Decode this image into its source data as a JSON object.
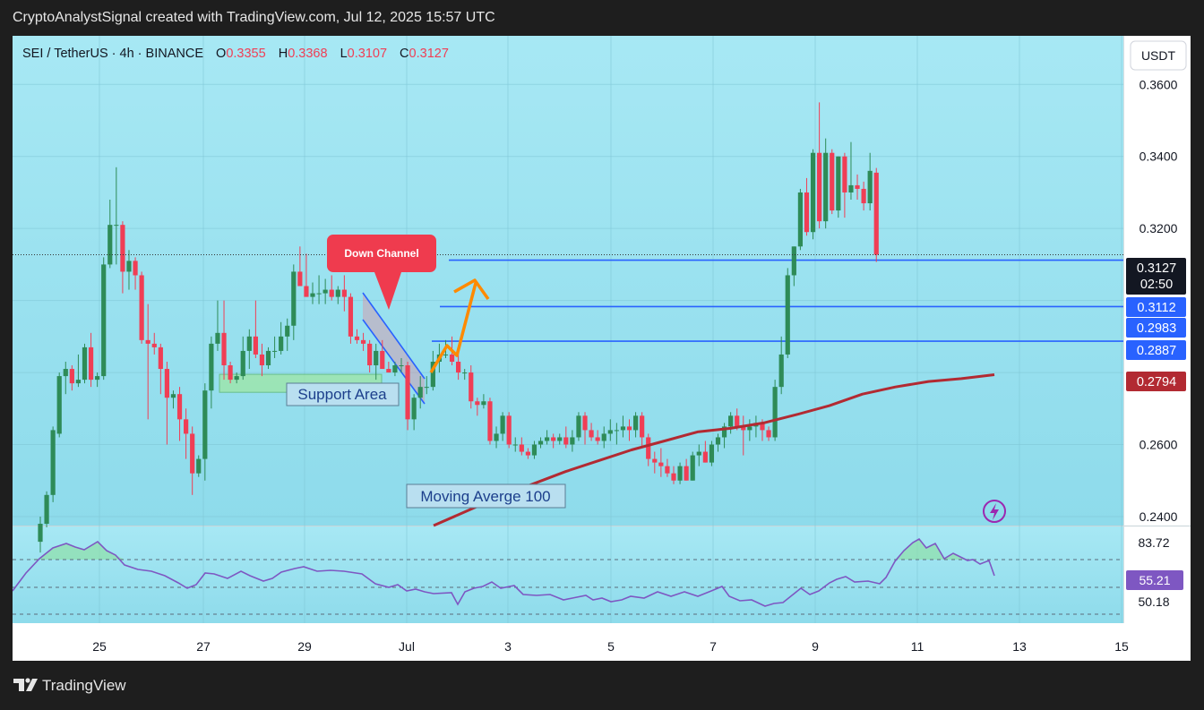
{
  "header": {
    "caption": "CryptoAnalystSignal created with TradingView.com, Jul 12, 2025 15:57 UTC"
  },
  "legend": {
    "symbol": "SEI / TetherUS · 4h · BINANCE",
    "open_label": "O",
    "open": "0.3355",
    "high_label": "H",
    "high": "0.3368",
    "low_label": "L",
    "low": "0.3107",
    "close_label": "C",
    "close": "0.3127"
  },
  "currency_button": "USDT",
  "footer": {
    "brand": "TradingView"
  },
  "colors": {
    "up": "#2e8b57",
    "down": "#f03e55",
    "ma": "#b22a32",
    "level": "#2962ff",
    "rsi": "#7e57c2",
    "bg_top": "#a7e8f4",
    "bg_bottom": "#8edbeb"
  },
  "annotations": {
    "down_channel": "Down Channel",
    "support_area": "Support Area",
    "moving_average": "Moving Averge 100"
  },
  "price_badges": {
    "last_price": "0.3127",
    "countdown": "02:50",
    "level_1": "0.3112",
    "level_2": "0.2983",
    "level_3": "0.2887",
    "ma_value": "0.2794"
  },
  "rsi_badges": {
    "top": "83.72",
    "current": "55.21",
    "bottom": "50.18"
  },
  "chart_data": {
    "type": "candlestick",
    "title": "SEI / TetherUS · 4h · BINANCE",
    "ohlc_last": {
      "open": 0.3355,
      "high": 0.3368,
      "low": 0.3107,
      "close": 0.3127
    },
    "y_ticks": [
      0.24,
      0.26,
      0.32,
      0.34,
      0.36
    ],
    "y_tick_labels": [
      "0.2400",
      "0.2600",
      "0.3200",
      "0.3400",
      "0.3600"
    ],
    "ylim": [
      0.2375,
      0.3735
    ],
    "x_ticks": [
      "25",
      "27",
      "29",
      "Jul",
      "3",
      "5",
      "7",
      "9",
      "11",
      "13",
      "15"
    ],
    "horizontal_levels": [
      0.3112,
      0.2983,
      0.2887
    ],
    "support_area": [
      0.2745,
      0.2795
    ],
    "moving_average_100": {
      "name": "Moving Averge 100",
      "values": [
        0.2375,
        0.2415,
        0.2455,
        0.249,
        0.2525,
        0.2555,
        0.2585,
        0.261,
        0.2635,
        0.2645,
        0.266,
        0.2683,
        0.2708,
        0.274,
        0.276,
        0.2775,
        0.2783,
        0.2794
      ]
    },
    "rsi": {
      "levels": [
        70,
        50,
        30
      ],
      "last": 55.21
    },
    "candles": [
      [
        0.233,
        0.24,
        0.23,
        0.238
      ],
      [
        0.238,
        0.247,
        0.237,
        0.246
      ],
      [
        0.246,
        0.265,
        0.244,
        0.264
      ],
      [
        0.263,
        0.28,
        0.262,
        0.279
      ],
      [
        0.279,
        0.283,
        0.274,
        0.281
      ],
      [
        0.281,
        0.282,
        0.275,
        0.277
      ],
      [
        0.277,
        0.285,
        0.276,
        0.278
      ],
      [
        0.278,
        0.288,
        0.277,
        0.287
      ],
      [
        0.287,
        0.291,
        0.276,
        0.278
      ],
      [
        0.278,
        0.28,
        0.276,
        0.279
      ],
      [
        0.279,
        0.312,
        0.278,
        0.31
      ],
      [
        0.31,
        0.328,
        0.309,
        0.321
      ],
      [
        0.321,
        0.337,
        0.31,
        0.321
      ],
      [
        0.321,
        0.322,
        0.302,
        0.308
      ],
      [
        0.308,
        0.314,
        0.303,
        0.311
      ],
      [
        0.311,
        0.312,
        0.303,
        0.307
      ],
      [
        0.307,
        0.308,
        0.288,
        0.289
      ],
      [
        0.289,
        0.299,
        0.267,
        0.288
      ],
      [
        0.288,
        0.291,
        0.285,
        0.287
      ],
      [
        0.287,
        0.288,
        0.274,
        0.281
      ],
      [
        0.281,
        0.283,
        0.26,
        0.273
      ],
      [
        0.273,
        0.275,
        0.27,
        0.274
      ],
      [
        0.274,
        0.276,
        0.261,
        0.267
      ],
      [
        0.267,
        0.27,
        0.256,
        0.263
      ],
      [
        0.263,
        0.265,
        0.246,
        0.252
      ],
      [
        0.252,
        0.257,
        0.251,
        0.256
      ],
      [
        0.256,
        0.277,
        0.25,
        0.275
      ],
      [
        0.275,
        0.29,
        0.27,
        0.288
      ],
      [
        0.288,
        0.3,
        0.286,
        0.291
      ],
      [
        0.291,
        0.3,
        0.278,
        0.282
      ],
      [
        0.282,
        0.283,
        0.277,
        0.278
      ],
      [
        0.278,
        0.28,
        0.277,
        0.279
      ],
      [
        0.279,
        0.29,
        0.278,
        0.286
      ],
      [
        0.286,
        0.292,
        0.281,
        0.29
      ],
      [
        0.29,
        0.3,
        0.284,
        0.285
      ],
      [
        0.285,
        0.288,
        0.279,
        0.282
      ],
      [
        0.282,
        0.287,
        0.281,
        0.286
      ],
      [
        0.286,
        0.29,
        0.284,
        0.286
      ],
      [
        0.286,
        0.294,
        0.285,
        0.29
      ],
      [
        0.29,
        0.295,
        0.286,
        0.293
      ],
      [
        0.293,
        0.31,
        0.289,
        0.308
      ],
      [
        0.308,
        0.315,
        0.305,
        0.304
      ],
      [
        0.304,
        0.313,
        0.301,
        0.301
      ],
      [
        0.301,
        0.305,
        0.299,
        0.302
      ],
      [
        0.302,
        0.307,
        0.299,
        0.302
      ],
      [
        0.302,
        0.306,
        0.299,
        0.303
      ],
      [
        0.303,
        0.307,
        0.3,
        0.301
      ],
      [
        0.301,
        0.304,
        0.299,
        0.303
      ],
      [
        0.303,
        0.307,
        0.297,
        0.301
      ],
      [
        0.301,
        0.302,
        0.288,
        0.29
      ],
      [
        0.29,
        0.292,
        0.288,
        0.289
      ],
      [
        0.289,
        0.291,
        0.286,
        0.288
      ],
      [
        0.288,
        0.289,
        0.28,
        0.282
      ],
      [
        0.282,
        0.288,
        0.278,
        0.286
      ],
      [
        0.286,
        0.289,
        0.282,
        0.281
      ],
      [
        0.281,
        0.283,
        0.28,
        0.28
      ],
      [
        0.28,
        0.283,
        0.279,
        0.282
      ],
      [
        0.282,
        0.284,
        0.28,
        0.282
      ],
      [
        0.282,
        0.283,
        0.264,
        0.267
      ],
      [
        0.267,
        0.274,
        0.264,
        0.273
      ],
      [
        0.273,
        0.279,
        0.27,
        0.276
      ],
      [
        0.276,
        0.279,
        0.274,
        0.276
      ],
      [
        0.276,
        0.286,
        0.275,
        0.283
      ],
      [
        0.283,
        0.288,
        0.28,
        0.285
      ],
      [
        0.285,
        0.289,
        0.284,
        0.285
      ],
      [
        0.285,
        0.29,
        0.282,
        0.283
      ],
      [
        0.283,
        0.286,
        0.278,
        0.28
      ],
      [
        0.28,
        0.281,
        0.278,
        0.28
      ],
      [
        0.28,
        0.282,
        0.27,
        0.272
      ],
      [
        0.272,
        0.273,
        0.268,
        0.271
      ],
      [
        0.271,
        0.274,
        0.27,
        0.272
      ],
      [
        0.272,
        0.273,
        0.26,
        0.261
      ],
      [
        0.261,
        0.265,
        0.259,
        0.263
      ],
      [
        0.263,
        0.269,
        0.261,
        0.268
      ],
      [
        0.268,
        0.269,
        0.259,
        0.26
      ],
      [
        0.26,
        0.262,
        0.258,
        0.26
      ],
      [
        0.26,
        0.262,
        0.257,
        0.258
      ],
      [
        0.258,
        0.259,
        0.256,
        0.257
      ],
      [
        0.257,
        0.261,
        0.256,
        0.26
      ],
      [
        0.26,
        0.262,
        0.259,
        0.261
      ],
      [
        0.261,
        0.264,
        0.26,
        0.262
      ],
      [
        0.262,
        0.263,
        0.259,
        0.261
      ],
      [
        0.261,
        0.263,
        0.26,
        0.262
      ],
      [
        0.262,
        0.265,
        0.259,
        0.26
      ],
      [
        0.26,
        0.264,
        0.258,
        0.262
      ],
      [
        0.262,
        0.269,
        0.261,
        0.268
      ],
      [
        0.268,
        0.269,
        0.26,
        0.264
      ],
      [
        0.264,
        0.266,
        0.261,
        0.262
      ],
      [
        0.262,
        0.264,
        0.26,
        0.261
      ],
      [
        0.261,
        0.265,
        0.259,
        0.263
      ],
      [
        0.263,
        0.267,
        0.261,
        0.264
      ],
      [
        0.264,
        0.266,
        0.26,
        0.264
      ],
      [
        0.264,
        0.268,
        0.262,
        0.265
      ],
      [
        0.265,
        0.267,
        0.261,
        0.264
      ],
      [
        0.264,
        0.269,
        0.262,
        0.268
      ],
      [
        0.268,
        0.269,
        0.259,
        0.262
      ],
      [
        0.262,
        0.263,
        0.254,
        0.256
      ],
      [
        0.256,
        0.258,
        0.252,
        0.255
      ],
      [
        0.255,
        0.259,
        0.251,
        0.254
      ],
      [
        0.254,
        0.256,
        0.251,
        0.252
      ],
      [
        0.252,
        0.254,
        0.249,
        0.25
      ],
      [
        0.25,
        0.255,
        0.249,
        0.254
      ],
      [
        0.254,
        0.256,
        0.25,
        0.25
      ],
      [
        0.25,
        0.258,
        0.25,
        0.257
      ],
      [
        0.257,
        0.26,
        0.254,
        0.258
      ],
      [
        0.258,
        0.261,
        0.255,
        0.255
      ],
      [
        0.255,
        0.261,
        0.254,
        0.26
      ],
      [
        0.26,
        0.263,
        0.258,
        0.262
      ],
      [
        0.262,
        0.266,
        0.259,
        0.265
      ],
      [
        0.265,
        0.269,
        0.263,
        0.268
      ],
      [
        0.268,
        0.27,
        0.264,
        0.265
      ],
      [
        0.265,
        0.268,
        0.257,
        0.264
      ],
      [
        0.264,
        0.267,
        0.261,
        0.265
      ],
      [
        0.265,
        0.268,
        0.262,
        0.266
      ],
      [
        0.266,
        0.267,
        0.261,
        0.264
      ],
      [
        0.264,
        0.265,
        0.261,
        0.262
      ],
      [
        0.262,
        0.278,
        0.261,
        0.276
      ],
      [
        0.276,
        0.29,
        0.274,
        0.285
      ],
      [
        0.285,
        0.309,
        0.284,
        0.307
      ],
      [
        0.307,
        0.315,
        0.304,
        0.315
      ],
      [
        0.315,
        0.331,
        0.314,
        0.33
      ],
      [
        0.33,
        0.334,
        0.318,
        0.319
      ],
      [
        0.319,
        0.342,
        0.317,
        0.341
      ],
      [
        0.341,
        0.355,
        0.32,
        0.322
      ],
      [
        0.322,
        0.345,
        0.32,
        0.341
      ],
      [
        0.341,
        0.342,
        0.324,
        0.325
      ],
      [
        0.325,
        0.34,
        0.323,
        0.34
      ],
      [
        0.34,
        0.341,
        0.323,
        0.33
      ],
      [
        0.33,
        0.344,
        0.328,
        0.332
      ],
      [
        0.332,
        0.335,
        0.328,
        0.331
      ],
      [
        0.331,
        0.333,
        0.325,
        0.327
      ],
      [
        0.327,
        0.341,
        0.325,
        0.336
      ],
      [
        0.3355,
        0.3368,
        0.3107,
        0.3127
      ]
    ]
  }
}
